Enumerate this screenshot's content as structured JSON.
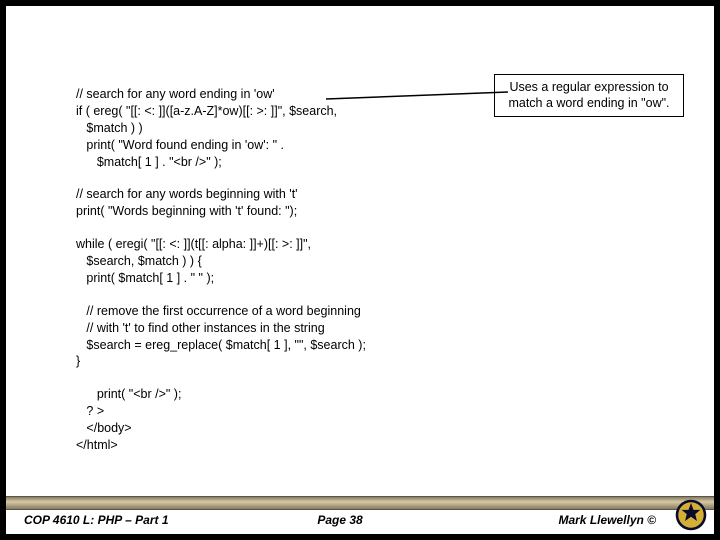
{
  "callout": "Uses a regular expression to match a word ending in \"ow\".",
  "code": {
    "l1": "// search for any word ending in 'ow'",
    "l2": "if ( ereg( \"[[: <: ]]([a-z.A-Z]*ow)[[: >: ]]\", $search,",
    "l3": "   $match ) )",
    "l4": "   print( \"Word found ending in 'ow': \" .",
    "l5": "      $match[ 1 ] . \"<br />\" );",
    "l6": "// search for any words beginning with 't'",
    "l7": "print( \"Words beginning with 't' found: \");",
    "l8": "while ( eregi( \"[[: <: ]](t[[: alpha: ]]+)[[: >: ]]\",",
    "l9": "   $search, $match ) ) {",
    "l10": "   print( $match[ 1 ] . \" \" );",
    "l11": "   // remove the first occurrence of a word beginning",
    "l12": "   // with 't' to find other instances in the string",
    "l13": "   $search = ereg_replace( $match[ 1 ], \"\", $search );",
    "l14": "}",
    "l15": "      print( \"<br />\" );",
    "l16": "   ? >",
    "l17": "   </body>",
    "l18": "</html>"
  },
  "footer": {
    "course": "COP 4610 L: PHP – Part 1",
    "page": "Page 38",
    "author": "Mark Llewellyn ©"
  }
}
